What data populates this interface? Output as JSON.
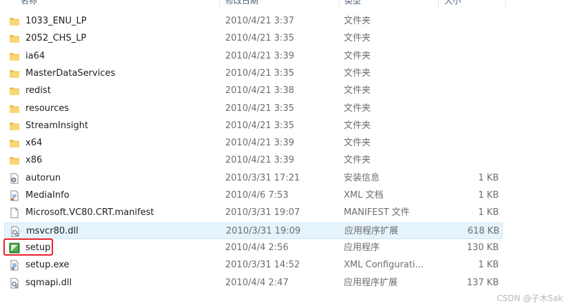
{
  "header": {
    "col_name": "名称",
    "col_date": "修改日期",
    "col_type": "类型",
    "col_size": "大小"
  },
  "files": [
    {
      "name": "1033_ENU_LP",
      "date": "2010/4/21 3:37",
      "type": "文件夹",
      "size": "",
      "icon": "folder-icon"
    },
    {
      "name": "2052_CHS_LP",
      "date": "2010/4/21 3:35",
      "type": "文件夹",
      "size": "",
      "icon": "folder-icon"
    },
    {
      "name": "ia64",
      "date": "2010/4/21 3:39",
      "type": "文件夹",
      "size": "",
      "icon": "folder-icon"
    },
    {
      "name": "MasterDataServices",
      "date": "2010/4/21 3:35",
      "type": "文件夹",
      "size": "",
      "icon": "folder-icon"
    },
    {
      "name": "redist",
      "date": "2010/4/21 3:38",
      "type": "文件夹",
      "size": "",
      "icon": "folder-icon"
    },
    {
      "name": "resources",
      "date": "2010/4/21 3:35",
      "type": "文件夹",
      "size": "",
      "icon": "folder-icon"
    },
    {
      "name": "StreamInsight",
      "date": "2010/4/21 3:35",
      "type": "文件夹",
      "size": "",
      "icon": "folder-icon"
    },
    {
      "name": "x64",
      "date": "2010/4/21 3:39",
      "type": "文件夹",
      "size": "",
      "icon": "folder-icon"
    },
    {
      "name": "x86",
      "date": "2010/4/21 3:39",
      "type": "文件夹",
      "size": "",
      "icon": "folder-icon"
    },
    {
      "name": "autorun",
      "date": "2010/3/31 17:21",
      "type": "安装信息",
      "size": "1 KB",
      "icon": "settings-file-icon"
    },
    {
      "name": "MediaInfo",
      "date": "2010/4/6 7:53",
      "type": "XML 文档",
      "size": "1 KB",
      "icon": "xml-document-icon"
    },
    {
      "name": "Microsoft.VC80.CRT.manifest",
      "date": "2010/3/31 19:07",
      "type": "MANIFEST 文件",
      "size": "1 KB",
      "icon": "blank-file-icon"
    },
    {
      "name": "msvcr80.dll",
      "date": "2010/3/31 19:09",
      "type": "应用程序扩展",
      "size": "618 KB",
      "icon": "dll-file-icon",
      "selected": true
    },
    {
      "name": "setup",
      "date": "2010/4/4 2:56",
      "type": "应用程序",
      "size": "130 KB",
      "icon": "setup-application-icon"
    },
    {
      "name": "setup.exe",
      "date": "2010/3/31 14:52",
      "type": "XML Configurati...",
      "size": "1 KB",
      "icon": "config-file-icon"
    },
    {
      "name": "sqmapi.dll",
      "date": "2010/4/4 2:47",
      "type": "应用程序扩展",
      "size": "137 KB",
      "icon": "dll-file-icon"
    }
  ],
  "watermark": "CSDN @子木Sak"
}
